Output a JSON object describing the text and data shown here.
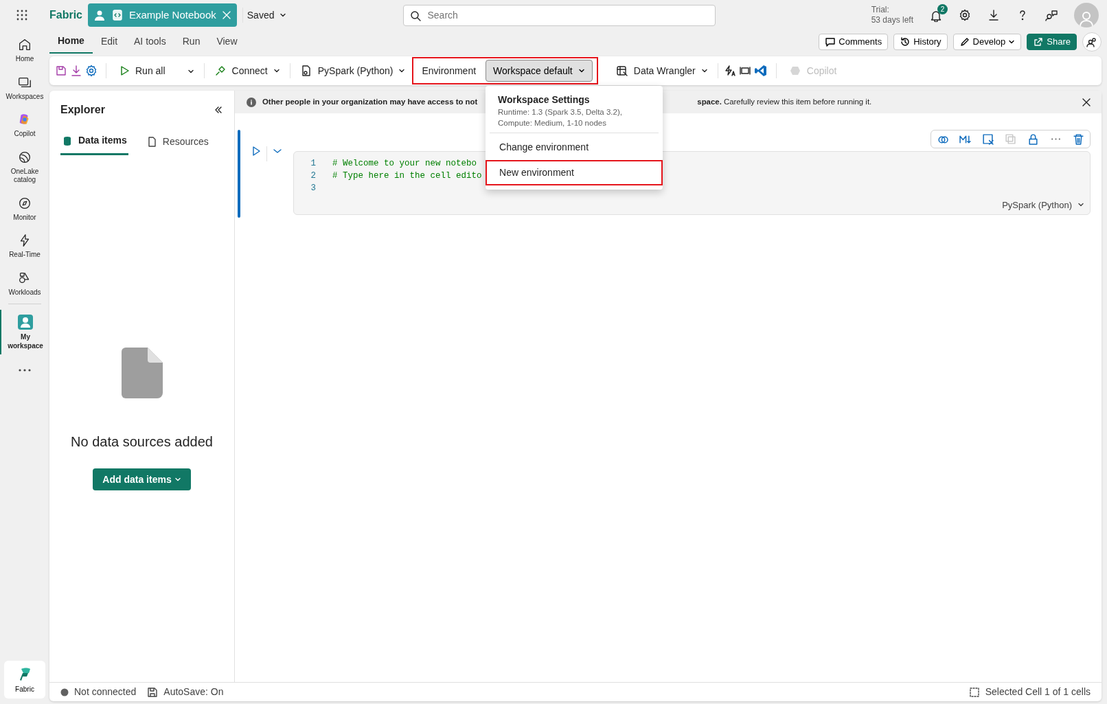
{
  "top_bar": {
    "app_name": "Fabric",
    "item_tab": {
      "label": "Example Notebook"
    },
    "save_status": "Saved",
    "search": {
      "placeholder": "Search"
    },
    "trial": {
      "line_1": "Trial:",
      "line_2": "53 days left"
    },
    "notifications_badge": "2"
  },
  "rail": {
    "items": [
      {
        "label": "Home",
        "selected": false
      },
      {
        "label": "Workspaces",
        "selected": false
      },
      {
        "label": "Copilot",
        "selected": false
      },
      {
        "label": "OneLake catalog",
        "selected": false
      },
      {
        "label": "Monitor",
        "selected": false
      },
      {
        "label": "Real-Time",
        "selected": false
      },
      {
        "label": "Workloads",
        "selected": false
      },
      {
        "label": "My workspace",
        "selected": true
      }
    ],
    "footer": {
      "label": "Fabric"
    }
  },
  "ribbon": {
    "tabs": [
      {
        "label": "Home",
        "selected": true
      },
      {
        "label": "Edit",
        "selected": false
      },
      {
        "label": "AI tools",
        "selected": false
      },
      {
        "label": "Run",
        "selected": false
      },
      {
        "label": "View",
        "selected": false
      }
    ],
    "actions": [
      {
        "label": "Comments",
        "kind": "comments"
      },
      {
        "label": "History",
        "kind": "history"
      },
      {
        "label": "Develop",
        "kind": "develop"
      },
      {
        "label": "Share",
        "kind": "share"
      }
    ]
  },
  "toolbar": {
    "run_all": "Run all",
    "connect": "Connect",
    "language": "PySpark (Python)",
    "environment": {
      "label": "Environment",
      "value": "Workspace default",
      "highlighted": true,
      "expanded": true
    },
    "data_wrangler": "Data Wrangler",
    "copilot": {
      "label": "Copilot",
      "disabled": true
    }
  },
  "environment_menu": {
    "header": "Workspace Settings",
    "details": [
      "Runtime: 1.3 (Spark 3.5, Delta 3.2),",
      "Compute: Medium, 1-10 nodes"
    ],
    "items": [
      {
        "label": "Change environment",
        "highlighted": false
      },
      {
        "label": "New environment",
        "highlighted": true
      }
    ]
  },
  "explorer": {
    "title": "Explorer",
    "tabs": [
      {
        "label": "Data items",
        "selected": true
      },
      {
        "label": "Resources",
        "selected": false
      }
    ],
    "empty_message": "No data sources added",
    "add_button": "Add data items"
  },
  "banner": {
    "text_start": "Other people in your organization may have access to not",
    "text_end": "**space.** Carefully review this item before running it."
  },
  "cell": {
    "selected": true,
    "lines": [
      {
        "number": "1",
        "code": "# Welcome to your new notebo"
      },
      {
        "number": "2",
        "code": "# Type here in the cell edito"
      },
      {
        "number": "3"
      }
    ],
    "language": "PySpark (Python)"
  },
  "status_bar": {
    "connection": "Not connected",
    "autosave": "AutoSave: On",
    "selection": "Selected Cell 1 of 1 cells"
  }
}
